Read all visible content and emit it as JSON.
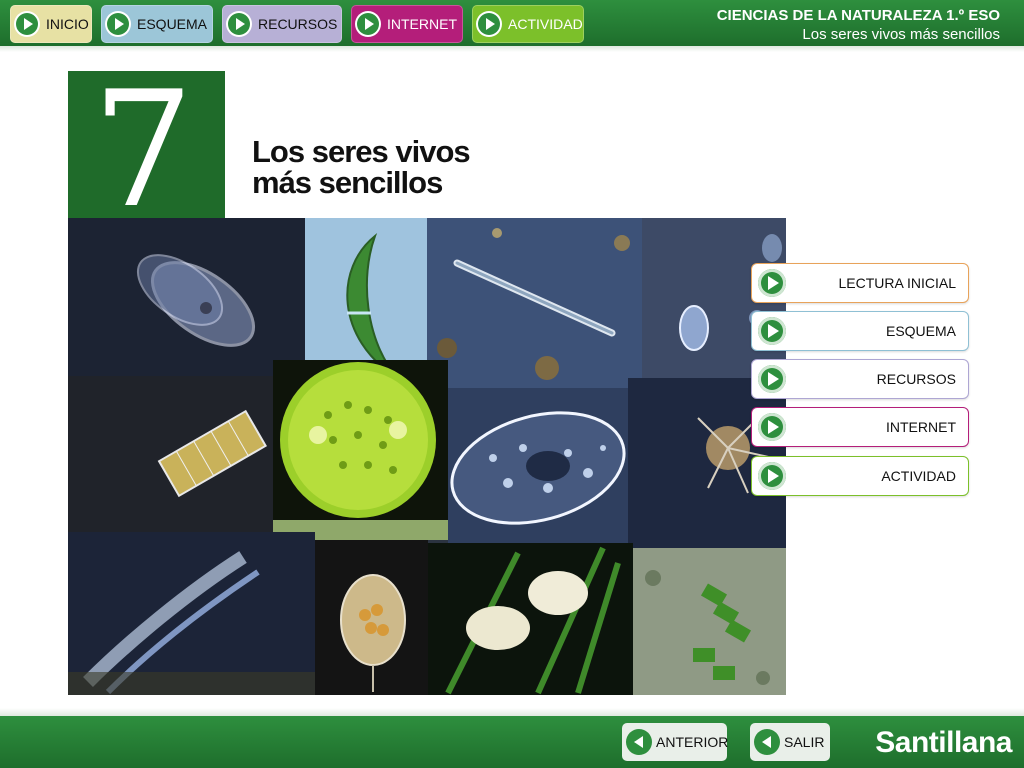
{
  "header": {
    "nav": [
      {
        "label": "INICIO"
      },
      {
        "label": "ESQUEMA"
      },
      {
        "label": "RECURSOS"
      },
      {
        "label": "INTERNET"
      },
      {
        "label": "ACTIVIDAD"
      }
    ],
    "course": "CIENCIAS DE LA NATURALEZA 1.º ESO",
    "unit": "Los seres vivos más sencillos"
  },
  "chapter": {
    "number": "7",
    "title_line1": "Los seres vivos",
    "title_line2": "más sencillos"
  },
  "menu": [
    {
      "label": "LECTURA INICIAL"
    },
    {
      "label": "ESQUEMA"
    },
    {
      "label": "RECURSOS"
    },
    {
      "label": "INTERNET"
    },
    {
      "label": "ACTIVIDAD"
    }
  ],
  "footer": {
    "prev": "ANTERIOR",
    "exit": "SALIR",
    "brand": "Santillana"
  },
  "colors": {
    "green": "#1f6b2a",
    "inicio": "#e7e1a4",
    "esquema": "#9cc6d8",
    "recursos": "#b7b0d6",
    "internet": "#b41e7a",
    "actividad": "#7cc02a"
  }
}
